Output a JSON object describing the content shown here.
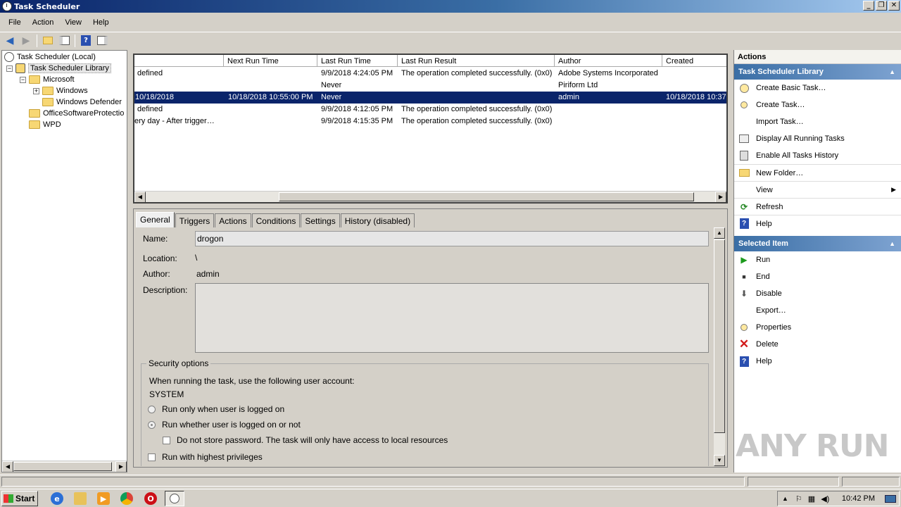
{
  "window": {
    "title": "Task Scheduler"
  },
  "menu": [
    "File",
    "Action",
    "View",
    "Help"
  ],
  "tree": {
    "root": "Task Scheduler (Local)",
    "library": "Task Scheduler Library",
    "microsoft": "Microsoft",
    "windows": "Windows",
    "windows_defender": "Windows Defender",
    "office": "OfficeSoftwareProtectio",
    "wpd": "WPD"
  },
  "task_list": {
    "columns": [
      "Next Run Time",
      "Last Run Time",
      "Last Run Result",
      "Author",
      "Created"
    ],
    "rows": [
      {
        "trigger": "defined",
        "next_run": "",
        "last_run": "9/9/2018 4:24:05 PM",
        "result": "The operation completed successfully. (0x0)",
        "author": "Adobe Systems Incorporated",
        "created": ""
      },
      {
        "trigger": "",
        "next_run": "",
        "last_run": "Never",
        "result": "",
        "author": "Piriform Ltd",
        "created": ""
      },
      {
        "trigger": "10/18/2018",
        "next_run": "10/18/2018 10:55:00 PM",
        "last_run": "Never",
        "result": "",
        "author": "admin",
        "created": "10/18/2018 10:37"
      },
      {
        "trigger": "defined",
        "next_run": "",
        "last_run": "9/9/2018 4:12:05 PM",
        "result": "The operation completed successfully. (0x0)",
        "author": "",
        "created": ""
      },
      {
        "trigger": "ery day - After trigger…",
        "next_run": "",
        "last_run": "9/9/2018 4:15:35 PM",
        "result": "The operation completed successfully. (0x0)",
        "author": "",
        "created": ""
      }
    ]
  },
  "detail": {
    "tabs": [
      "General",
      "Triggers",
      "Actions",
      "Conditions",
      "Settings",
      "History (disabled)"
    ],
    "name_label": "Name:",
    "name_value": "drogon",
    "location_label": "Location:",
    "location_value": "\\",
    "author_label": "Author:",
    "author_value": "admin",
    "description_label": "Description:",
    "security_title": "Security options",
    "account_prompt": "When running the task, use the following user account:",
    "account": "SYSTEM",
    "radio_logged_on": "Run only when user is logged on",
    "radio_whether": "Run whether user is logged on or not",
    "check_no_store": "Do not store password.  The task will only have access to local resources",
    "check_highest": "Run with highest privileges"
  },
  "actions_pane": {
    "header": "Actions",
    "section_library": "Task Scheduler Library",
    "library_items": [
      "Create Basic Task…",
      "Create Task…",
      "Import Task…",
      "Display All Running Tasks",
      "Enable All Tasks History",
      "New Folder…",
      "View",
      "Refresh",
      "Help"
    ],
    "section_selected": "Selected Item",
    "selected_items": [
      "Run",
      "End",
      "Disable",
      "Export…",
      "Properties",
      "Delete",
      "Help"
    ]
  },
  "taskbar": {
    "start": "Start",
    "clock": "10:42 PM"
  },
  "watermark": "ANY RUN"
}
